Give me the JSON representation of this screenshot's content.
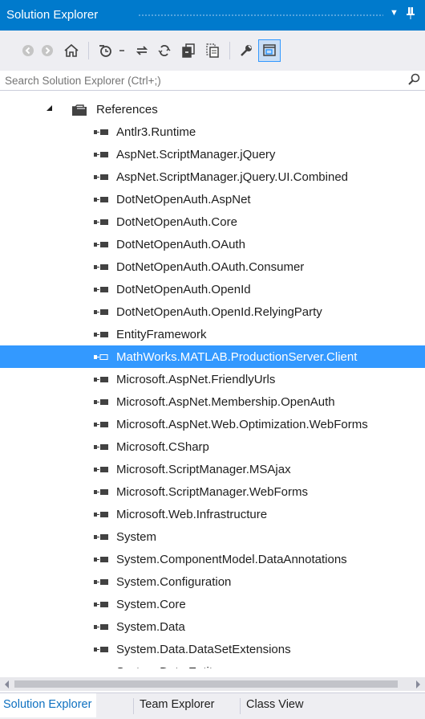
{
  "title_bar": {
    "title": "Solution Explorer",
    "dropdown_icon": "▼",
    "pin_icon": "ᚓ"
  },
  "search": {
    "placeholder": "Search Solution Explorer (Ctrl+;)"
  },
  "tree": {
    "root_label": "References",
    "items": [
      "Antlr3.Runtime",
      "AspNet.ScriptManager.jQuery",
      "AspNet.ScriptManager.jQuery.UI.Combined",
      "DotNetOpenAuth.AspNet",
      "DotNetOpenAuth.Core",
      "DotNetOpenAuth.OAuth",
      "DotNetOpenAuth.OAuth.Consumer",
      "DotNetOpenAuth.OpenId",
      "DotNetOpenAuth.OpenId.RelyingParty",
      "EntityFramework",
      "MathWorks.MATLAB.ProductionServer.Client",
      "Microsoft.AspNet.FriendlyUrls",
      "Microsoft.AspNet.Membership.OpenAuth",
      "Microsoft.AspNet.Web.Optimization.WebForms",
      "Microsoft.CSharp",
      "Microsoft.ScriptManager.MSAjax",
      "Microsoft.ScriptManager.WebForms",
      "Microsoft.Web.Infrastructure",
      "System",
      "System.ComponentModel.DataAnnotations",
      "System.Configuration",
      "System.Core",
      "System.Data",
      "System.Data.DataSetExtensions",
      "System.Data.Entity"
    ],
    "selected": "MathWorks.MATLAB.ProductionServer.Client"
  },
  "tabs": [
    "Solution Explorer",
    "Team Explorer",
    "Class View"
  ],
  "colors": {
    "accent": "#007acc",
    "selection": "#3399ff",
    "tab_active_text": "#0e70c0"
  }
}
